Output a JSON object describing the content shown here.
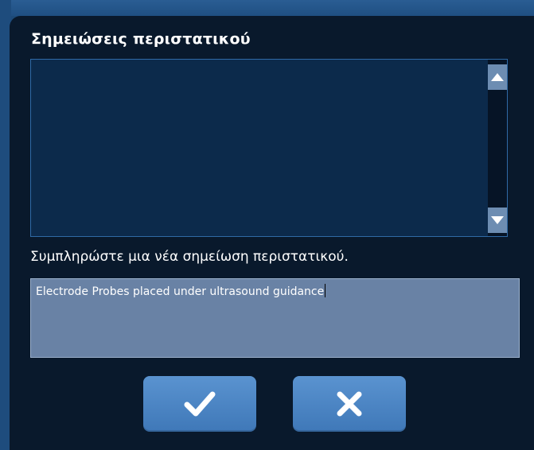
{
  "dialog": {
    "title": "Σημειώσεις περιστατικού",
    "notes_text": "",
    "prompt": "Συμπληρώστε μια νέα σημείωση περιστατικού.",
    "input_value": "Electrode Probes placed under ultrasound guidance",
    "scroll_up_icon": "triangle-up-icon",
    "scroll_down_icon": "triangle-down-icon",
    "confirm_icon": "checkmark-icon",
    "cancel_icon": "x-icon"
  },
  "colors": {
    "dialog_background": "#09192c",
    "notes_background": "#0c2a4b",
    "input_background": "#6982a5",
    "button_blue": "#4a85c5",
    "scroll_button": "#6d8db2"
  }
}
